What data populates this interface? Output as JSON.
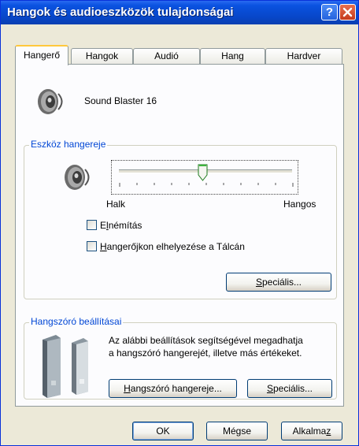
{
  "window": {
    "title": "Hangok és audioeszközök tulajdonságai",
    "help_glyph": "?"
  },
  "tabs": [
    {
      "label": "Hangerő",
      "active": true
    },
    {
      "label": "Hangok",
      "active": false
    },
    {
      "label": "Audió",
      "active": false
    },
    {
      "label": "Hang",
      "active": false
    },
    {
      "label": "Hardver",
      "active": false
    }
  ],
  "device": {
    "name": "Sound Blaster 16"
  },
  "volume_group": {
    "title": "Eszköz hangereje",
    "slider": {
      "value": 0.48,
      "min_label": "Halk",
      "max_label": "Hangos"
    },
    "mute": {
      "pre": "E",
      "ul": "l",
      "post": "némítás",
      "checked": false
    },
    "taskbar": {
      "pre": "",
      "ul": "H",
      "post": "angerőjkon elhelyezése a Tálcán",
      "checked": false
    },
    "advanced": {
      "pre": "",
      "ul": "S",
      "post": "peciális..."
    }
  },
  "speaker_group": {
    "title": "Hangszóró beállításai",
    "description_line1": "Az alábbi beállítások segítségével megadhatja",
    "description_line2": "a hangszóró hangerejét, illetve más értékeket.",
    "speaker_volume": {
      "pre": "",
      "ul": "H",
      "post": "angszóró hangereje..."
    },
    "advanced": {
      "pre": "",
      "ul": "S",
      "post": "peciális..."
    }
  },
  "footer": {
    "ok": "OK",
    "cancel": "Mégse",
    "apply": {
      "pre": "Alkalma",
      "ul": "z",
      "post": ""
    }
  }
}
